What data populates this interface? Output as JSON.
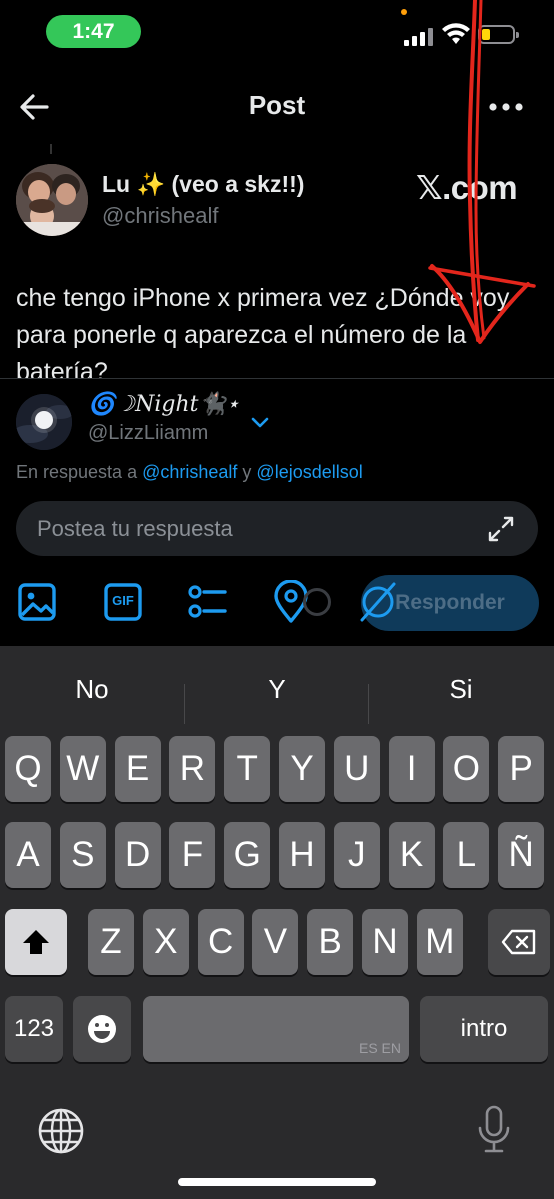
{
  "status_bar": {
    "time": "1:47"
  },
  "header": {
    "title": "Post"
  },
  "post": {
    "author_name": "Lu ✨ (veo a skz!!)",
    "author_handle": "@chrishealf",
    "watermark": "𝕏.com",
    "text": "che tengo iPhone x primera vez ¿Dónde voy para ponerle q aparezca el número de la batería?"
  },
  "reply": {
    "account_name": "🌀☽𝑁𝑖𝑔ℎ𝑡🐈‍⬛⋆",
    "account_handle": "@LizzLiiamm",
    "replying_prefix": "En respuesta a ",
    "mention_1": "@chrishealf",
    "replying_joiner": " y ",
    "mention_2": "@lejosdellsol",
    "placeholder": "Postea tu respuesta",
    "submit_label": "Responder"
  },
  "toolbar": {
    "icons": [
      "image-icon",
      "gif-icon",
      "poll-icon",
      "location-icon"
    ],
    "gif_label": "GIF"
  },
  "keyboard": {
    "suggestions": [
      "No",
      "Y",
      "Si"
    ],
    "row1": [
      "Q",
      "W",
      "E",
      "R",
      "T",
      "Y",
      "U",
      "I",
      "O",
      "P"
    ],
    "row2": [
      "A",
      "S",
      "D",
      "F",
      "G",
      "H",
      "J",
      "K",
      "L",
      "Ñ"
    ],
    "row3": [
      "Z",
      "X",
      "C",
      "V",
      "B",
      "N",
      "M"
    ],
    "numbers_key": "123",
    "return_key": "intro",
    "space_languages": "ES EN"
  },
  "colors": {
    "accent": "#1d9bf0",
    "annotation": "#e3261c",
    "status_pill": "#34c759"
  }
}
